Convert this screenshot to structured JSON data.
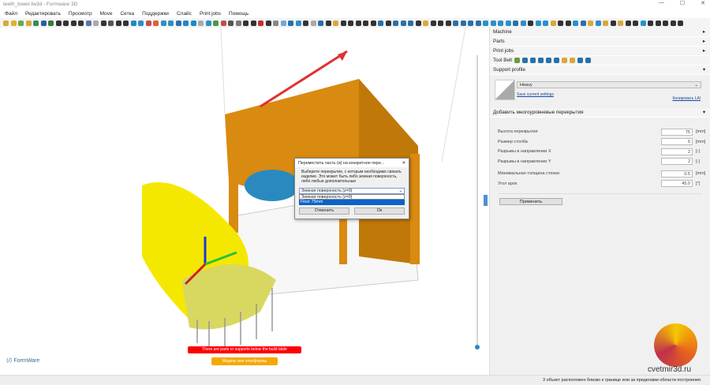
{
  "window": {
    "title": "teeth_tower.fw3d - Formware 3D",
    "minimize": "—",
    "maximize": "☐",
    "close": "✕"
  },
  "menu": [
    "Файл",
    "Редактировать",
    "Просмотр",
    "Move",
    "Сетка",
    "Поддержки",
    "Слайс",
    "Print jobs",
    "Помощь"
  ],
  "toolbar_icon_colors": [
    "#d9a83a",
    "#e0b030",
    "#6aa84f",
    "#d9a83a",
    "#3a8a5a",
    "#2b5fa0",
    "#3a7a3a",
    "#333",
    "#333",
    "#333",
    "#333",
    "#5577aa",
    "#aaa",
    "#333",
    "#555",
    "#333",
    "#333",
    "#1e88c8",
    "#2a90c8",
    "#c0504d",
    "#e06030",
    "#2a90c8",
    "#2a90c8",
    "#2a70a8",
    "#1e88c8",
    "#1e88c8",
    "#aaa",
    "#2a90c8",
    "#4a9a4a",
    "#c0504d",
    "#555",
    "#777",
    "#333",
    "#333",
    "#c03030",
    "#333",
    "#888",
    "#6fa8dc",
    "#2a70a8",
    "#2a90c8",
    "#333",
    "#aaa",
    "#2a70a8",
    "#333",
    "#d9a83a",
    "#333",
    "#333",
    "#333",
    "#333",
    "#333",
    "#2a70a8",
    "#333",
    "#2a70a8",
    "#2a70a8",
    "#2a70a8",
    "#333",
    "#d9a83a",
    "#333",
    "#333",
    "#333",
    "#2a70a8",
    "#2a70a8",
    "#2a70a8",
    "#2a70a8",
    "#2a90c8",
    "#2a90c8",
    "#2a90c8",
    "#2a90c8",
    "#2a70a8",
    "#2a90c8",
    "#333",
    "#2a90c8",
    "#2a90c8",
    "#d9a83a",
    "#333",
    "#333",
    "#2a90c8",
    "#2a70a8",
    "#d9a83a",
    "#2a90c8",
    "#d9a83a",
    "#333",
    "#d9a83a",
    "#333",
    "#333",
    "#2a90c8",
    "#333",
    "#333",
    "#333",
    "#333",
    "#333"
  ],
  "panel": {
    "machine": "Machine",
    "parts": "Parts",
    "print_jobs": "Print jobs",
    "tool_belt": "Tool Belt",
    "tool_belt_colors": [
      "#6a9a3a",
      "#2a70a8",
      "#2a70a8",
      "#2a70a8",
      "#2a70a8",
      "#2a70a8",
      "#d9a83a",
      "#d9a83a",
      "#2a70a8",
      "#2a70a8"
    ],
    "support_profile": "Support profile",
    "profile_value": "Heavy",
    "save_settings": "Save current settings",
    "copy_link": "Копировать LAl",
    "multilevel": "Добавить многоуровневые перекрытия",
    "fields": [
      {
        "label": "Высота перекрытия",
        "value": "75",
        "unit": "[mm]"
      },
      {
        "label": "Размер столба",
        "value": "6",
        "unit": "[mm]"
      },
      {
        "label": "Разрывы в направлении X",
        "value": "2",
        "unit": "[-]"
      },
      {
        "label": "Разрывы в направлении Y",
        "value": "2",
        "unit": "[-]"
      },
      {
        "label": "Минимальная толщина стенки",
        "value": "0.5",
        "unit": "[mm]"
      },
      {
        "label": "Угол арок",
        "value": "45.0",
        "unit": "[°]"
      }
    ],
    "apply": "Применить"
  },
  "dialog": {
    "title": "Переместить часть (и) на конкретное пере...",
    "text": "Выберите перекрытие, с которым необходимо связать изделие. Это может быть либо земная поверхность, либо любые дополнительные",
    "selected": "Земная поверхность (z=0)",
    "options": [
      "Земная поверхность (z=0)",
      "Floor 75mm"
    ],
    "cancel": "Отменить",
    "ok": "Ок"
  },
  "viewport": {
    "warning": "There are parts or supports below the build table",
    "off_platform": "Модель вне платформы",
    "logo": "FormWare"
  },
  "watermark": "cvetmir3d.ru",
  "status": "3 объект расположен близко к границе или за пределами области построения"
}
